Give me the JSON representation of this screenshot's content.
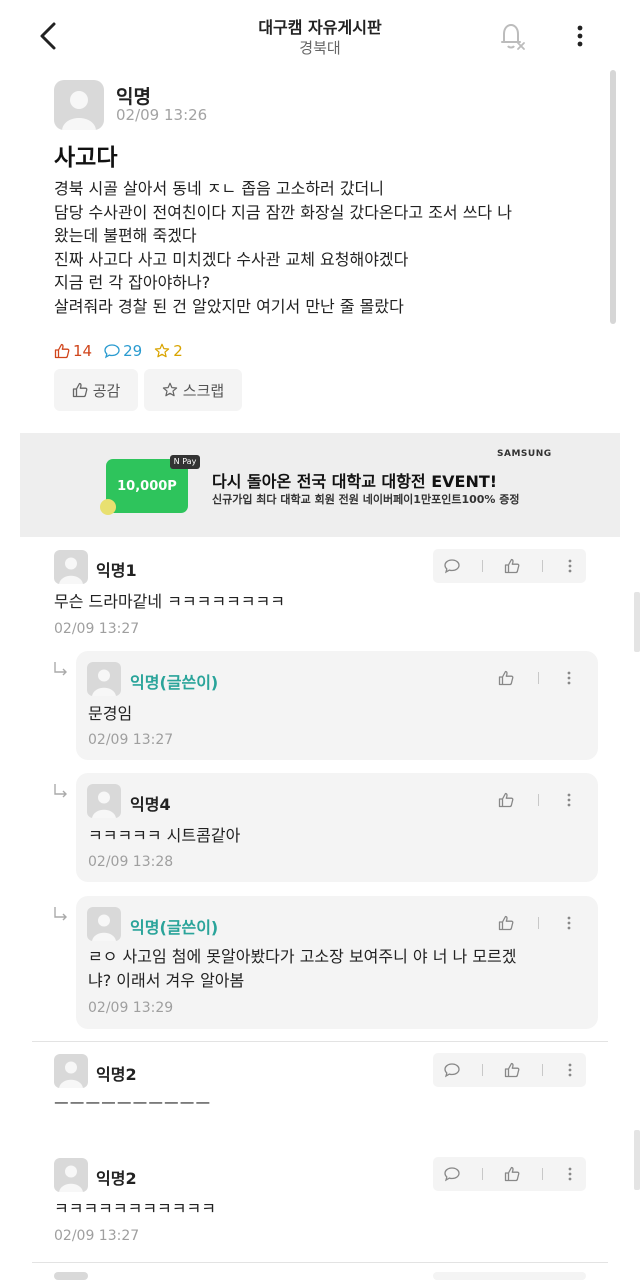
{
  "header": {
    "title": "대구캠 자유게시판",
    "subtitle": "경북대",
    "back_icon": "chevron-left-icon",
    "bell_icon": "bell-off-icon",
    "more_icon": "more-vertical-icon"
  },
  "post": {
    "author": "익명",
    "time": "02/09 13:26",
    "title": "사고다",
    "body_lines": [
      "경북 시골 살아서 동네 ㅈㄴ 좁음  고소하러 갔더니",
      "담당 수사관이 전여친이다 지금 잠깐 화장실 갔다온다고 조서 쓰다 나",
      "왔는데 불편해 죽겠다",
      "진짜 사고다 사고 미치겠다 수사관 교체 요청해야겠다",
      "지금 런 각 잡아야하나?",
      "살려줘라 경찰 된 건 알았지만 여기서 만난 줄 몰랐다"
    ],
    "stats": {
      "likes": "14",
      "comments": "29",
      "scraps": "2"
    },
    "like_button": "공감",
    "scrap_button": "스크랩"
  },
  "ad": {
    "brand": "SAMSUNG",
    "card_amount": "10,000P",
    "pay_badge": "N Pay",
    "headline": "다시 돌아온 전국 대학교 대항전 EVENT!",
    "subline": "신규가입 최다 대학교 회원 전원 네이버페이1만포인트100% 증정"
  },
  "comments": [
    {
      "author": "익명1",
      "text": [
        "무슨 드라마같네 ㅋㅋㅋㅋㅋㅋㅋㅋ"
      ],
      "time": "02/09 13:27"
    },
    {
      "author": "익명(글쓴이)",
      "text": [
        "문경임"
      ],
      "time": "02/09 13:27"
    },
    {
      "author": "익명4",
      "text": [
        "ㅋㅋㅋㅋㅋ 시트콤같아"
      ],
      "time": "02/09 13:28"
    },
    {
      "author": "익명(글쓴이)",
      "text": [
        "ㄹㅇ 사고임 첨에 못알아봤다가 고소장 보여주니 야 너 나 모르겠",
        "냐? 이래서 겨우 알아봄"
      ],
      "time": "02/09 13:29"
    },
    {
      "author": "익명2",
      "text": [
        "ㅡㅡㅡㅡㅡㅡㅡㅡㅡㅡ"
      ],
      "time": ""
    },
    {
      "author": "익명2",
      "text": [
        "ㅋㅋㅋㅋㅋㅋㅋㅋㅋㅋㅋ"
      ],
      "time": "02/09 13:27"
    }
  ]
}
